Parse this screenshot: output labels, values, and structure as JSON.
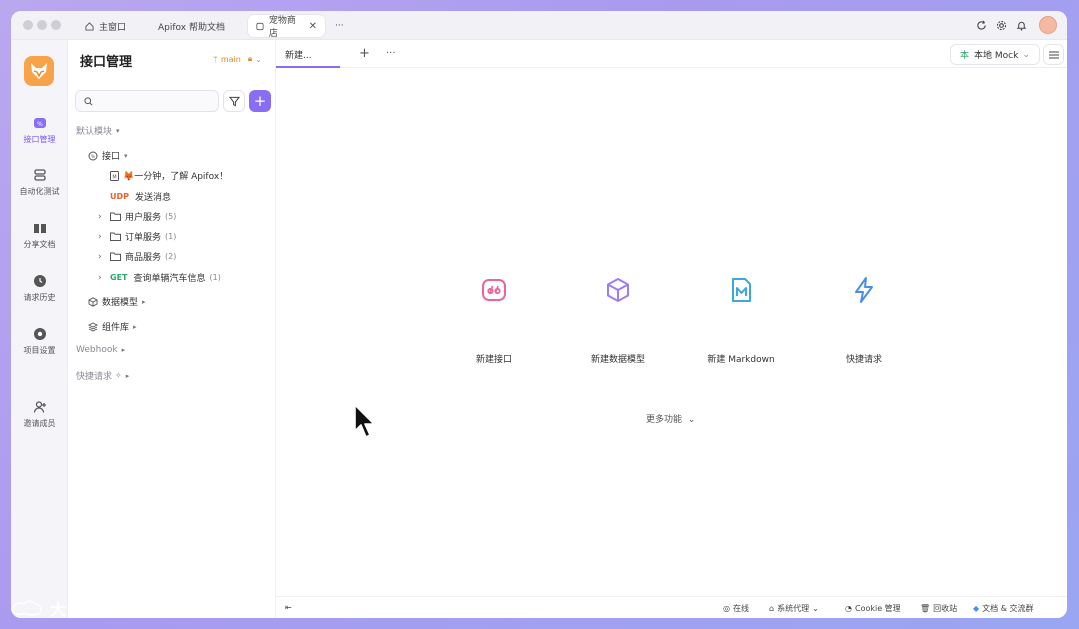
{
  "titlebar": {
    "tabs": [
      {
        "label": "主窗口",
        "icon": "home-icon"
      },
      {
        "label": "Apifox 帮助文档"
      },
      {
        "label": "宠物商店",
        "icon": "project-icon",
        "active": true
      }
    ],
    "more_label": "···"
  },
  "rail": {
    "items": [
      {
        "label": "接口管理",
        "icon": "api-icon",
        "active": true
      },
      {
        "label": "自动化测试",
        "icon": "automation-icon"
      },
      {
        "label": "分享文档",
        "icon": "book-icon"
      },
      {
        "label": "请求历史",
        "icon": "clock-icon"
      },
      {
        "label": "项目设置",
        "icon": "settings-icon"
      },
      {
        "label": "邀请成员",
        "icon": "invite-icon"
      }
    ]
  },
  "side": {
    "title": "接口管理",
    "branch": "main",
    "search_placeholder": "",
    "tree": {
      "default_module": "默认模块",
      "interfaces": "接口",
      "doc_item": "🦊一分钟，了解 Apifox！",
      "udp_method": "UDP",
      "udp_label": "发送消息",
      "folders": [
        {
          "label": "用户服务",
          "count": "(5)"
        },
        {
          "label": "订单服务",
          "count": "(1)"
        },
        {
          "label": "商品服务",
          "count": "(2)"
        }
      ],
      "get_method": "GET",
      "get_label": "查询单辆汽车信息",
      "get_count": "(1)",
      "data_models": "数据模型",
      "components": "组件库",
      "webhook": "Webhook",
      "quick_request": "快捷请求"
    }
  },
  "main": {
    "doc_tab": "新建...",
    "add_tab": "+",
    "more_tabs": "···",
    "mock_env": "本地 Mock",
    "actions": [
      {
        "label": "新建接口",
        "icon": "api-icon",
        "color": "#e8669e"
      },
      {
        "label": "新建数据模型",
        "icon": "cube-icon",
        "color": "#9b7ef5"
      },
      {
        "label": "新建 Markdown",
        "icon": "markdown-icon",
        "color": "#3fa7e0"
      },
      {
        "label": "快捷请求",
        "icon": "lightning-icon",
        "color": "#4a8fe8"
      }
    ],
    "more_features": "更多功能"
  },
  "statusbar": {
    "online": "在线",
    "proxy": "系统代理",
    "cookie": "Cookie 管理",
    "recycle": "回收站",
    "docs": "文档 & 交流群"
  },
  "watermark": "大数跨境",
  "colors": {
    "accent": "#8a6df5",
    "udp": "#e8622c",
    "get": "#2da56a",
    "branch": "#e08a1e"
  }
}
